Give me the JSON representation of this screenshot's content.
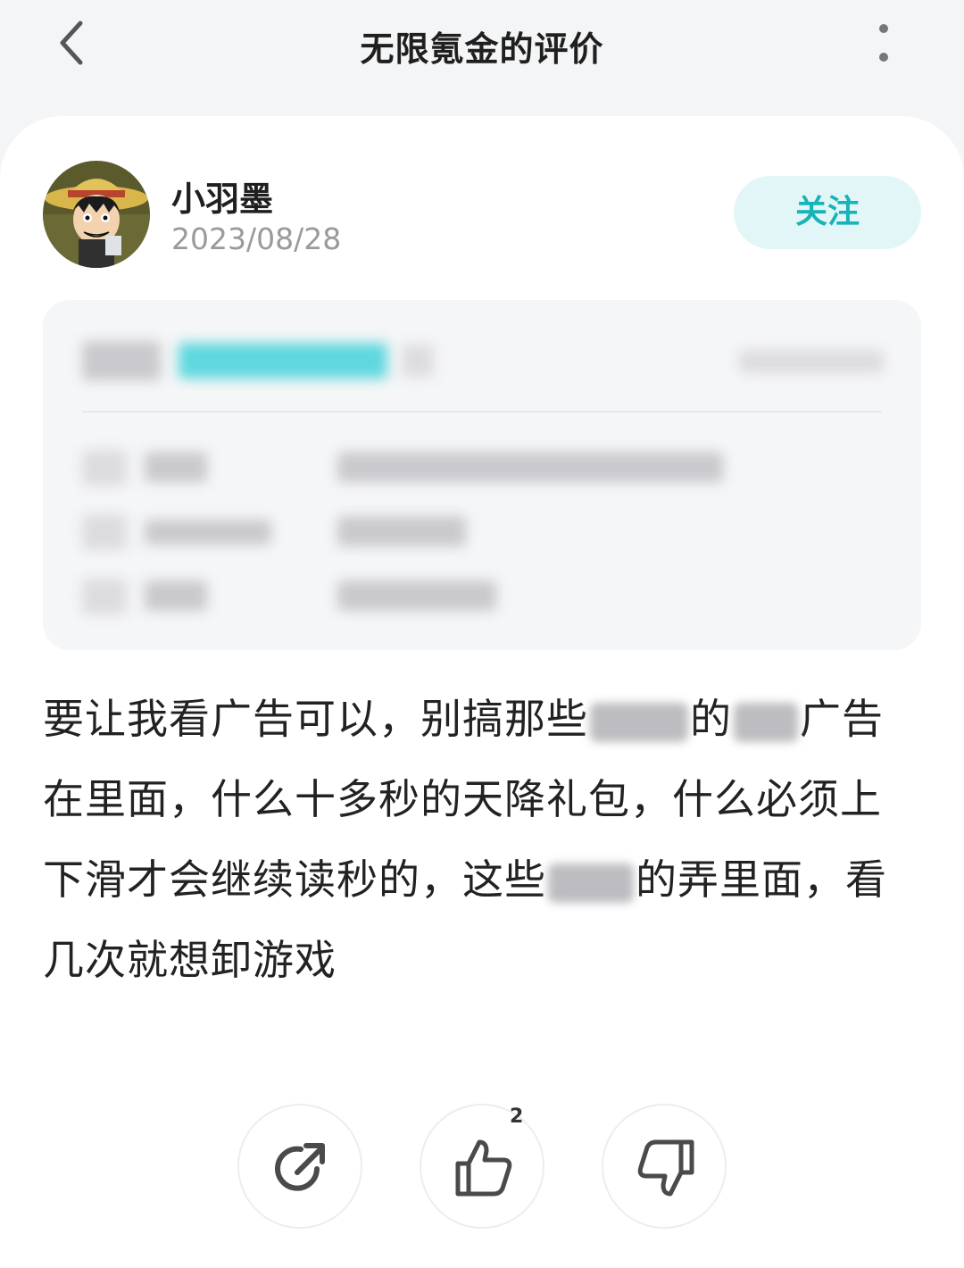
{
  "header": {
    "title": "无限氪金的评价",
    "back_icon": "chevron-left-icon",
    "more_icon": "more-vertical-icon"
  },
  "author": {
    "name": "小羽墨",
    "date": "2023/08/28",
    "avatar_icon": "cartoon-avatar-icon",
    "follow_label": "关注"
  },
  "review": {
    "lines": [
      [
        "要让我看广告可以，别搞那些",
        "",
        "的",
        "",
        "广告"
      ],
      [
        "在里面，什么十多秒的天降礼包，什么必须上"
      ],
      [
        "下滑才会继续读秒的，这些",
        "",
        "的弄里面，看"
      ],
      [
        "几次就想卸游戏"
      ]
    ]
  },
  "actions": {
    "share_icon": "share-icon",
    "like_icon": "thumbs-up-icon",
    "like_count": "2",
    "dislike_icon": "thumbs-down-icon"
  },
  "colors": {
    "accent": "#16b3b8",
    "follow_bg": "#e3f6f7",
    "background": "#f4f5f6"
  }
}
